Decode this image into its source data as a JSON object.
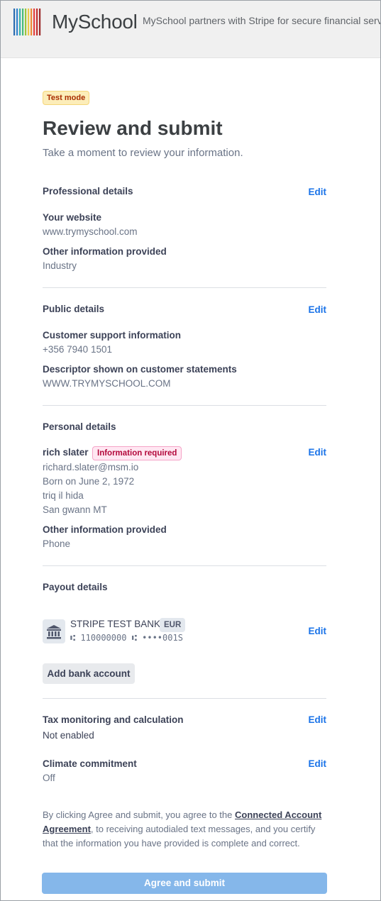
{
  "header": {
    "brand": "MySchool",
    "partner_text": "MySchool partners with Stripe for secure financial services."
  },
  "test_mode": "Test mode",
  "title": "Review and submit",
  "subtitle": "Take a moment to review your information.",
  "edit_label": "Edit",
  "professional": {
    "title": "Professional details",
    "website_label": "Your website",
    "website_value": "www.trymyschool.com",
    "other_label": "Other information provided",
    "other_value": "Industry"
  },
  "public": {
    "title": "Public details",
    "support_label": "Customer support information",
    "support_value": "+356 7940 1501",
    "descriptor_label": "Descriptor shown on customer statements",
    "descriptor_value": "WWW.TRYMYSCHOOL.COM"
  },
  "personal": {
    "title": "Personal details",
    "name": "rich slater",
    "badge": "Information required",
    "email": "richard.slater@msm.io",
    "dob": "Born on June 2, 1972",
    "address1": "triq il hida",
    "address2": "San gwann MT",
    "other_label": "Other information provided",
    "other_value": "Phone"
  },
  "payout": {
    "title": "Payout details",
    "bank_name": "STRIPE TEST BANK",
    "currency": "EUR",
    "routing": "110000000",
    "account": "••••001S",
    "add_bank": "Add bank account"
  },
  "tax": {
    "title": "Tax monitoring and calculation",
    "value": "Not enabled"
  },
  "climate": {
    "title": "Climate commitment",
    "value": "Off"
  },
  "agreement": {
    "prefix": "By clicking Agree and submit, you agree to the ",
    "link": "Connected Account Agreement",
    "suffix": ", to receiving autodialed text messages, and you certify that the information you have provided is complete and correct."
  },
  "submit_label": "Agree and submit",
  "colors": {
    "accent": "#1a73e8",
    "submit_disabled": "#85b7ea",
    "test_badge_bg": "#fcedb9",
    "required_badge_bg": "#ffe7f2"
  }
}
